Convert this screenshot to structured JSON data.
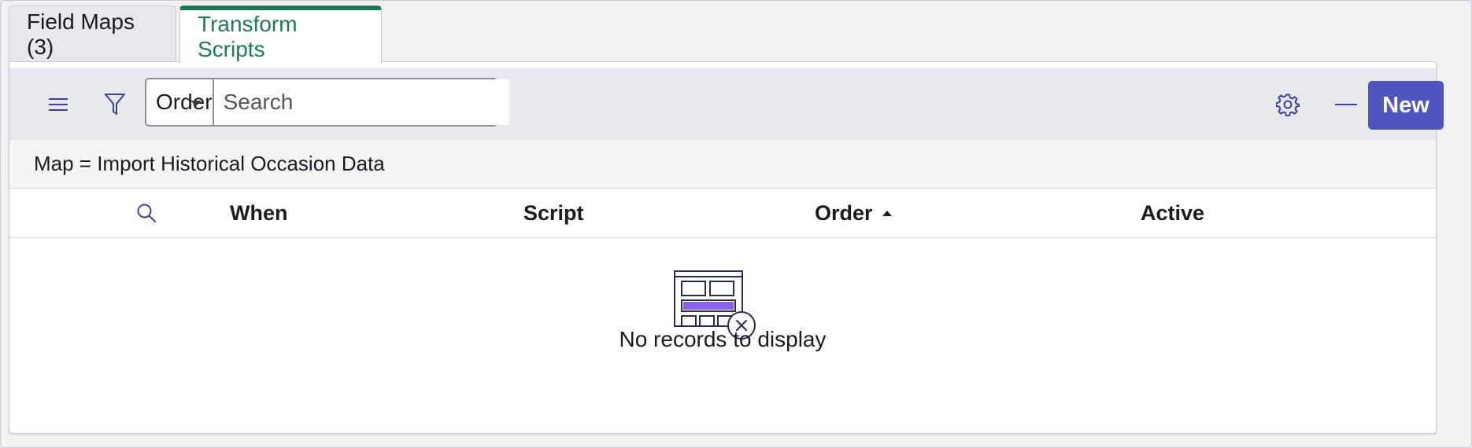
{
  "tabs": [
    {
      "label": "Field Maps (3)",
      "active": false
    },
    {
      "label": "Transform Scripts",
      "active": true
    }
  ],
  "toolbar": {
    "menu_icon": "hamburger-menu-icon",
    "filter_icon": "filter-funnel-icon",
    "search_field_selected": "Order",
    "search_placeholder": "Search",
    "settings_icon": "gear-icon",
    "collapse_icon": "minus-icon",
    "new_label": "New"
  },
  "breadcrumb": "Map = Import Historical Occasion Data",
  "table": {
    "search_icon": "search-icon",
    "columns": [
      {
        "label": "When"
      },
      {
        "label": "Script"
      },
      {
        "label": "Order",
        "sort": "ascending"
      },
      {
        "label": "Active"
      }
    ],
    "rows": []
  },
  "empty_state": {
    "icon": "no-records-illustration-icon",
    "message": "No records to display"
  },
  "colors": {
    "active_tab": "#1d7a57",
    "primary_button": "#5055c0",
    "icon_accent": "#3d3f9e",
    "illustration_fill": "#8a63e8"
  }
}
